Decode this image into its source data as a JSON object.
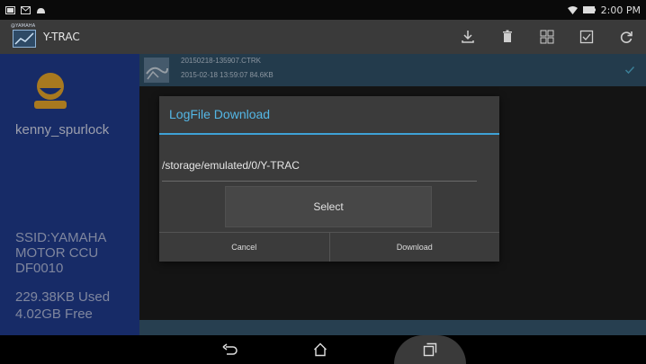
{
  "status_bar": {
    "time": "2:00 PM",
    "icons": [
      "screen-icon",
      "mail-icon",
      "android-icon",
      "wifi-icon",
      "battery-icon"
    ]
  },
  "app_bar": {
    "brand": "@YAMAHA",
    "title": "Y-TRAC",
    "actions": [
      "download-icon",
      "trash-icon",
      "grid-icon",
      "checkbox-icon",
      "refresh-icon"
    ]
  },
  "sidebar": {
    "username": "kenny_spurlock",
    "ssid": "SSID:YAMAHA MOTOR CCU DF0010",
    "used": "229.38KB Used",
    "free": "4.02GB Free"
  },
  "file_list": {
    "items": [
      {
        "name": "20150218-135907.CTRK",
        "meta": "2015-02-18 13:59:07 84.6KB",
        "checked": true
      }
    ]
  },
  "dialog": {
    "title": "LogFile Download",
    "path_value": "/storage/emulated/0/Y-TRAC",
    "select_label": "Select",
    "cancel_label": "Cancel",
    "download_label": "Download"
  },
  "colors": {
    "accent": "#3ea2d6",
    "sidebar": "#1f3a8a",
    "selected_row": "#2f4f66"
  }
}
